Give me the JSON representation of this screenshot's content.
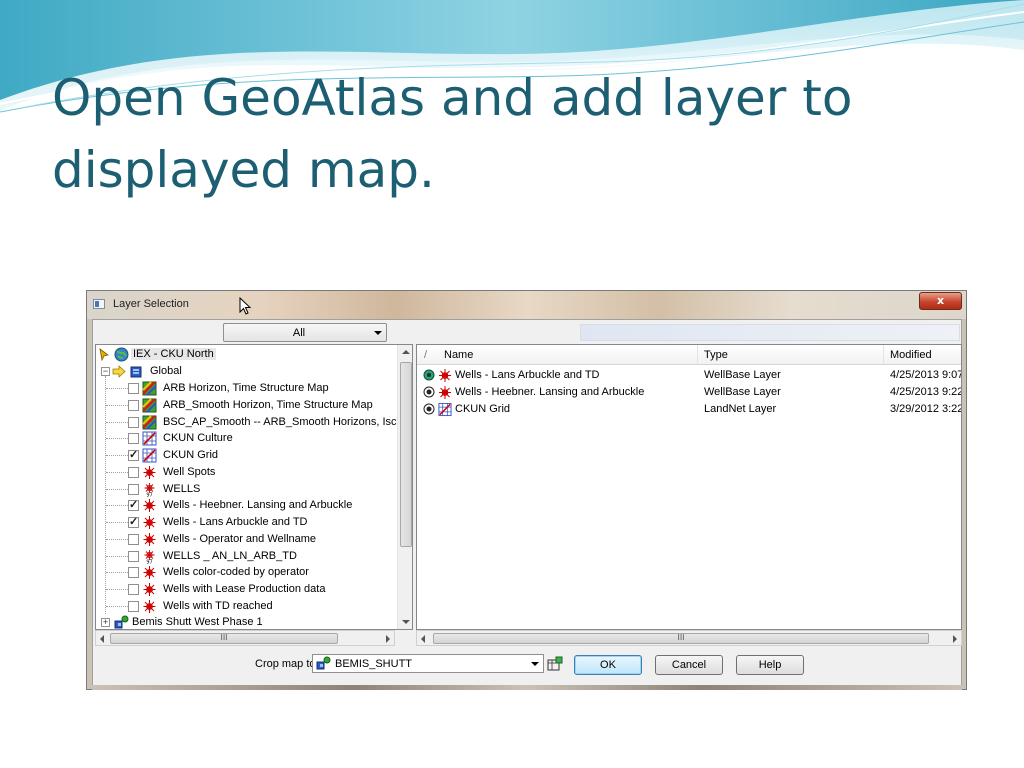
{
  "slide": {
    "title": "Open GeoAtlas and add layer to displayed map."
  },
  "window": {
    "title": "Layer Selection",
    "close_label": "x"
  },
  "filter": {
    "value": "All"
  },
  "tree": {
    "root": "IEX - CKU North",
    "group": "Global",
    "items": [
      {
        "label": "ARB Horizon, Time Structure Map",
        "checked": false,
        "icon": "grid-map-icon"
      },
      {
        "label": "ARB_Smooth Horizon, Time Structure Map",
        "checked": false,
        "icon": "grid-map-icon"
      },
      {
        "label": "BSC_AP_Smooth -- ARB_Smooth Horizons, Isc",
        "checked": false,
        "icon": "grid-map-icon"
      },
      {
        "label": "CKUN Culture",
        "checked": false,
        "icon": "culture-icon"
      },
      {
        "label": "CKUN Grid",
        "checked": true,
        "icon": "culture-icon"
      },
      {
        "label": "Well Spots",
        "checked": false,
        "icon": "well-icon"
      },
      {
        "label": "WELLS",
        "checked": false,
        "icon": "well-symbol-icon"
      },
      {
        "label": "Wells - Heebner. Lansing and Arbuckle",
        "checked": true,
        "icon": "well-icon"
      },
      {
        "label": "Wells - Lans Arbuckle and TD",
        "checked": true,
        "icon": "well-icon"
      },
      {
        "label": "Wells - Operator and Wellname",
        "checked": false,
        "icon": "well-icon"
      },
      {
        "label": "WELLS _ AN_LN_ARB_TD",
        "checked": false,
        "icon": "well-symbol-icon"
      },
      {
        "label": "Wells color-coded by operator",
        "checked": false,
        "icon": "well-icon"
      },
      {
        "label": "Wells with Lease Production data",
        "checked": false,
        "icon": "well-icon"
      },
      {
        "label": "Wells with TD reached",
        "checked": false,
        "icon": "well-icon"
      }
    ],
    "next_group": "Bemis Shutt West  Phase 1",
    "scroll_grip": "III"
  },
  "list": {
    "columns": [
      "/",
      "Name",
      "Type",
      "Modified"
    ],
    "rows": [
      {
        "name": "Wells - Lans Arbuckle and TD",
        "type": "WellBase Layer",
        "modified": "4/25/2013 9:07"
      },
      {
        "name": "Wells - Heebner. Lansing and Arbuckle",
        "type": "WellBase Layer",
        "modified": "4/25/2013 9:22"
      },
      {
        "name": "CKUN Grid",
        "type": "LandNet Layer",
        "modified": "3/29/2012 3:22"
      }
    ],
    "scroll_grip": "III"
  },
  "bottom": {
    "crop_label": "Crop map to:",
    "crop_value": "BEMIS_SHUTT",
    "ok": "OK",
    "cancel": "Cancel",
    "help": "Help"
  },
  "colors": {
    "title": "#1c5e72",
    "wave": "#4fb3c9"
  }
}
